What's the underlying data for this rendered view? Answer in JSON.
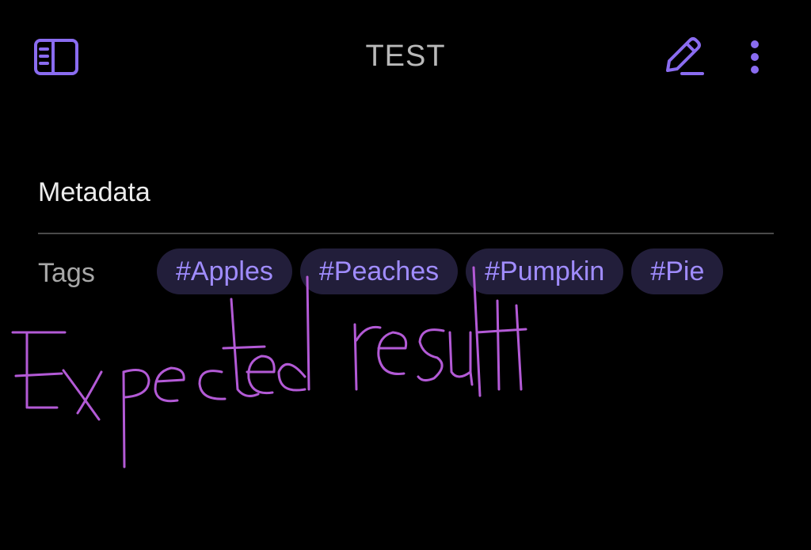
{
  "header": {
    "title": "TEST",
    "left_icon": "sidebar-toggle-icon",
    "right_icons": [
      "pencil-edit-icon",
      "vertical-ellipsis-icon"
    ]
  },
  "properties": {
    "heading": "Metadata",
    "rows": [
      {
        "label": "Tags",
        "tags": [
          "#Apples",
          "#Peaches",
          "#Pumpkin",
          "#Pie"
        ]
      }
    ]
  },
  "annotation": {
    "text": "Expected result",
    "color": "#b35ad6"
  },
  "colors": {
    "background": "#000000",
    "accent": "#8a6cf0",
    "tag_background": "#221e3a",
    "tag_text": "#a08cff",
    "title_text": "#b9b9b9"
  }
}
